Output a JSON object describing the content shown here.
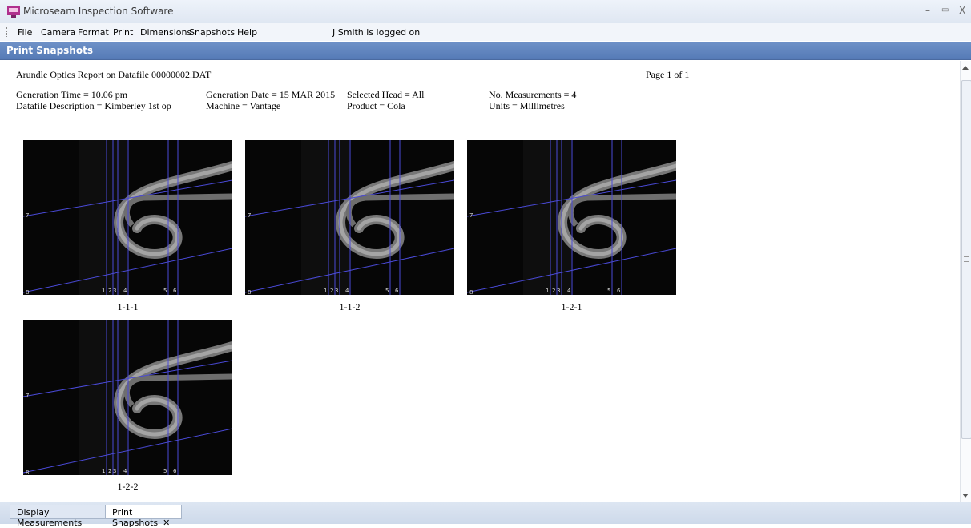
{
  "window": {
    "title": "Microseam Inspection Software",
    "minimize": "–",
    "restore": "▭",
    "close": "X"
  },
  "menu": {
    "items": [
      {
        "label": "File"
      },
      {
        "label": "Camera"
      },
      {
        "label": "Format"
      },
      {
        "label": "Print"
      },
      {
        "label": "Dimensions"
      },
      {
        "label": "Snapshots"
      },
      {
        "label": "Help"
      }
    ],
    "status": "J Smith is logged on"
  },
  "panel": {
    "title": "Print Snapshots"
  },
  "report": {
    "title": "Arundle Optics Report on Datafile 00000002.DAT",
    "page": "Page 1 of 1",
    "generation_time": "Generation Time = 10.06 pm",
    "datafile_description": "Datafile Description = Kimberley 1st op",
    "generation_date": "Generation Date = 15 MAR 2015",
    "machine": "Machine = Vantage",
    "selected_head": "Selected Head = All",
    "product": "Product = Cola",
    "no_measurements": "No. Measurements = 4",
    "units": "Units = Millimetres"
  },
  "snapshots": [
    {
      "caption": "1-1-1",
      "line_labels": [
        "1",
        "2",
        "3",
        "4",
        "5",
        "6",
        "7",
        "8"
      ]
    },
    {
      "caption": "1-1-2",
      "line_labels": [
        "1",
        "2",
        "3",
        "4",
        "5",
        "6",
        "7",
        "8"
      ]
    },
    {
      "caption": "1-2-1",
      "line_labels": [
        "1",
        "2",
        "3",
        "4",
        "5",
        "6",
        "7",
        "8"
      ]
    },
    {
      "caption": "1-2-2",
      "line_labels": [
        "1",
        "2",
        "3",
        "4",
        "5",
        "6",
        "7",
        "8"
      ]
    }
  ],
  "tabs": [
    {
      "label": "Display Measurements",
      "active": false
    },
    {
      "label": "Print Snapshots",
      "active": true,
      "close": "✕"
    }
  ],
  "colors": {
    "header_bar": "#6184c0",
    "overlay_lines": "#4a4ad8"
  }
}
